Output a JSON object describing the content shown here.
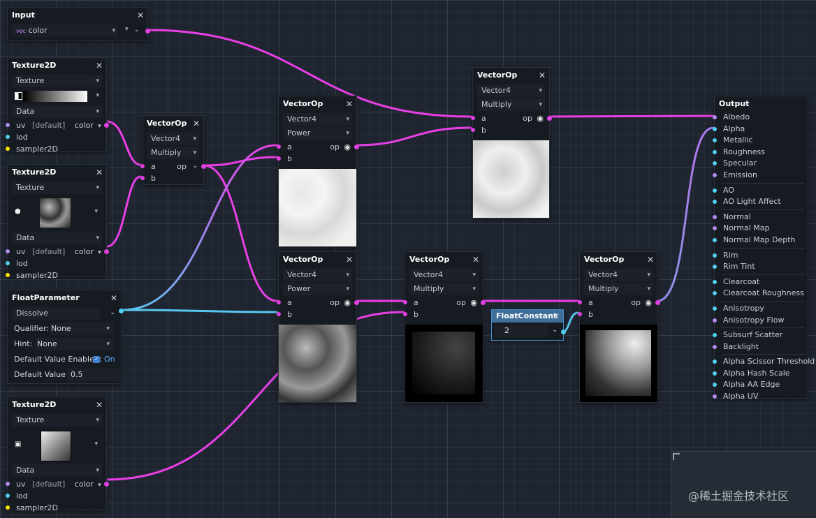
{
  "input_node": {
    "title": "Input",
    "type_prefix": "vec",
    "value": "color"
  },
  "texture1": {
    "title": "Texture2D",
    "texture_label": "Texture",
    "data_label": "Data",
    "uv_label": "uv",
    "uv_default": "[default]",
    "uv_mode": "color",
    "lod_label": "lod",
    "sampler_label": "sampler2D"
  },
  "texture2": {
    "title": "Texture2D",
    "texture_label": "Texture",
    "data_label": "Data",
    "uv_label": "uv",
    "uv_default": "[default]",
    "uv_mode": "color",
    "lod_label": "lod",
    "sampler_label": "sampler2D"
  },
  "texture3": {
    "title": "Texture2D",
    "texture_label": "Texture",
    "data_label": "Data",
    "uv_label": "uv",
    "uv_default": "[default]",
    "uv_mode": "color",
    "lod_label": "lod",
    "sampler_label": "sampler2D"
  },
  "float_param": {
    "title": "FloatParameter",
    "name": "Dissolve",
    "qualifier_label": "Qualifier:",
    "qualifier_value": "None",
    "hint_label": "Hint:",
    "hint_value": "None",
    "default_enabled_label": "Default Value Enabled:",
    "default_enabled_value": "On",
    "default_value_label": "Default Value:",
    "default_value": "0.5"
  },
  "vop1": {
    "title": "VectorOp",
    "type": "Vector4",
    "op": "Multiply",
    "a": "a",
    "b": "b",
    "out": "op"
  },
  "vop2": {
    "title": "VectorOp",
    "type": "Vector4",
    "op": "Power",
    "a": "a",
    "b": "b",
    "out": "op"
  },
  "vop3": {
    "title": "VectorOp",
    "type": "Vector4",
    "op": "Multiply",
    "a": "a",
    "b": "b",
    "out": "op"
  },
  "vop4": {
    "title": "VectorOp",
    "type": "Vector4",
    "op": "Power",
    "a": "a",
    "b": "b",
    "out": "op"
  },
  "vop5": {
    "title": "VectorOp",
    "type": "Vector4",
    "op": "Multiply",
    "a": "a",
    "b": "b",
    "out": "op"
  },
  "vop6": {
    "title": "VectorOp",
    "type": "Vector4",
    "op": "Multiply",
    "a": "a",
    "b": "b",
    "out": "op"
  },
  "float_const": {
    "title": "FloatConstant",
    "value": "2"
  },
  "output": {
    "title": "Output",
    "groups": [
      [
        "Albedo",
        "Alpha",
        "Metallic",
        "Roughness",
        "Specular",
        "Emission"
      ],
      [
        "AO",
        "AO Light Affect"
      ],
      [
        "Normal",
        "Normal Map",
        "Normal Map Depth"
      ],
      [
        "Rim",
        "Rim Tint"
      ],
      [
        "Clearcoat",
        "Clearcoat Roughness"
      ],
      [
        "Anisotropy",
        "Anisotropy Flow"
      ],
      [
        "Subsurf Scatter",
        "Backlight"
      ],
      [
        "Alpha Scissor Threshold",
        "Alpha Hash Scale",
        "Alpha AA Edge",
        "Alpha UV"
      ]
    ]
  },
  "watermark": "@稀土掘金技术社区",
  "colors": {
    "wire_vec": "#e93fe6",
    "wire_float": "#57c6ee",
    "port_purple": "#b489f0",
    "port_cyan": "#4fd0f0",
    "port_yellow": "#ffe600"
  }
}
